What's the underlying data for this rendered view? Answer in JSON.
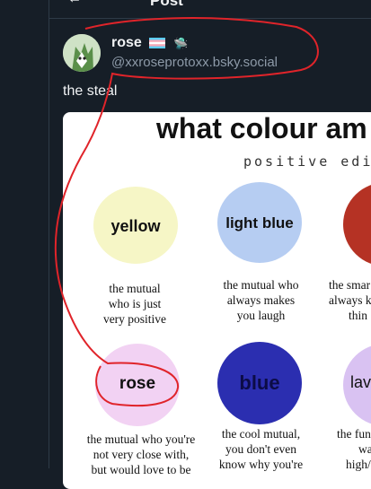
{
  "header": {
    "title": "Post",
    "back_icon": "arrow-left-icon"
  },
  "author": {
    "name": "rose",
    "handle": "@xxroseprotoxx.bsky.social",
    "badges": [
      "transgender-flag-icon",
      "ufo-icon"
    ]
  },
  "post": {
    "text": "the steal"
  },
  "image": {
    "title": "what colour am",
    "subtitle": "positive editi",
    "items": [
      {
        "label": "yellow",
        "desc": [
          "the mutual",
          "who is just",
          "very positive"
        ],
        "color": "#f6f6c6"
      },
      {
        "label": "light blue",
        "desc": [
          "the mutual who",
          "always makes",
          "you laugh"
        ],
        "color": "#b6cdf2"
      },
      {
        "label": "",
        "desc": [
          "the smar",
          "always k",
          "thin"
        ],
        "color": "#b53224"
      },
      {
        "label": "rose",
        "desc": [
          "the mutual who you're",
          "not very close with,",
          "but would love to be"
        ],
        "color": "#f2d2f3"
      },
      {
        "label": "blue",
        "desc": [
          "the cool mutual,",
          "you don't even",
          "know why you're"
        ],
        "color": "#2b2eb0"
      },
      {
        "label": "lav",
        "desc": [
          "the fun",
          "wa",
          "high/"
        ],
        "color": "#d9c2f2"
      }
    ]
  },
  "colors": {
    "background": "#161e27",
    "annotation": "#e0242a",
    "text": "#f1f3f5",
    "muted": "#8d9aa8"
  }
}
